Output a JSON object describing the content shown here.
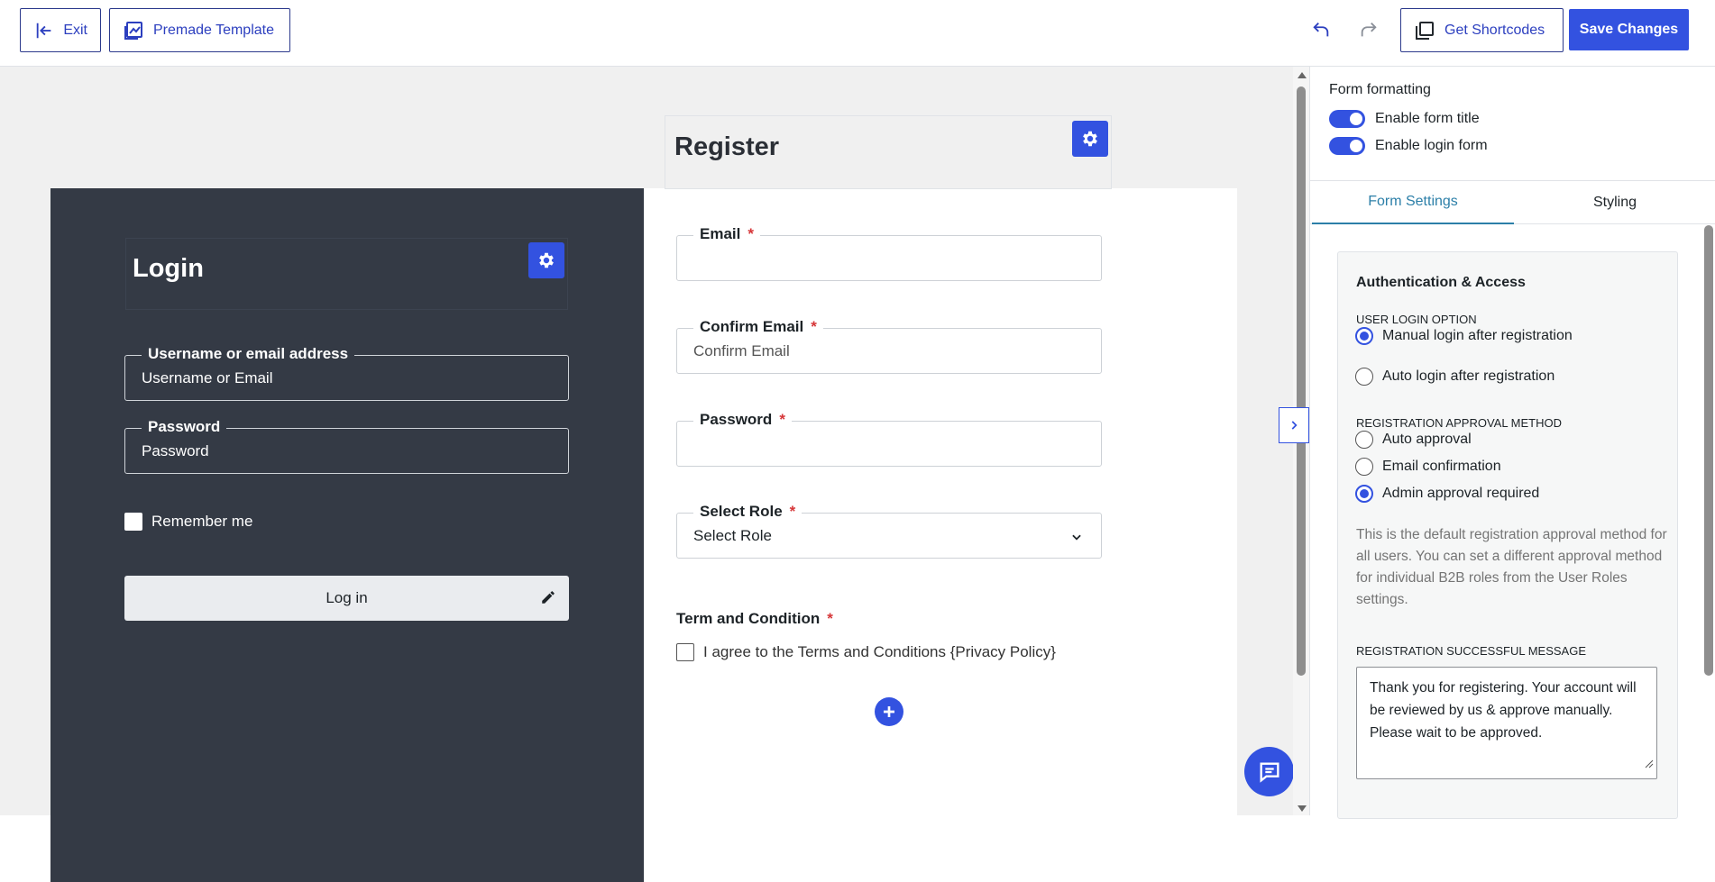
{
  "topbar": {
    "exit_label": "Exit",
    "premade_label": "Premade Template",
    "shortcodes_label": "Get Shortcodes",
    "save_label": "Save Changes"
  },
  "login": {
    "title": "Login",
    "username_label": "Username or email address",
    "username_placeholder": "Username or Email",
    "password_label": "Password",
    "password_placeholder": "Password",
    "remember_label": "Remember me",
    "button_label": "Log in"
  },
  "register": {
    "title": "Register",
    "email_label": "Email",
    "confirm_email_label": "Confirm Email",
    "confirm_email_placeholder": "Confirm Email",
    "password_label": "Password",
    "role_label": "Select Role",
    "role_value": "Select Role",
    "required_mark": "*",
    "term_label": "Term and Condition",
    "term_text": "I agree to the Terms and Conditions {Privacy Policy}"
  },
  "sidebar": {
    "heading": "Form formatting",
    "toggle_title": "Enable form title",
    "toggle_login": "Enable login form",
    "tab_form": "Form Settings",
    "tab_styling": "Styling",
    "card_title": "Authentication & Access",
    "login_option_label": "USER LOGIN OPTION",
    "login_options": [
      "Manual login after registration",
      "Auto login after registration"
    ],
    "approval_label": "REGISTRATION APPROVAL METHOD",
    "approval_options": [
      "Auto approval",
      "Email confirmation",
      "Admin approval required"
    ],
    "help_text": "This is the default registration approval method for all users. You can set a different approval method for individual B2B roles from the User Roles settings.",
    "success_label": "REGISTRATION SUCCESSFUL MESSAGE",
    "success_message": "Thank you for registering. Your account will be reviewed by us & approve manually. Please wait to be approved."
  },
  "colors": {
    "accent": "#3352e0",
    "login_bg": "#343a45",
    "required": "#d63638"
  }
}
